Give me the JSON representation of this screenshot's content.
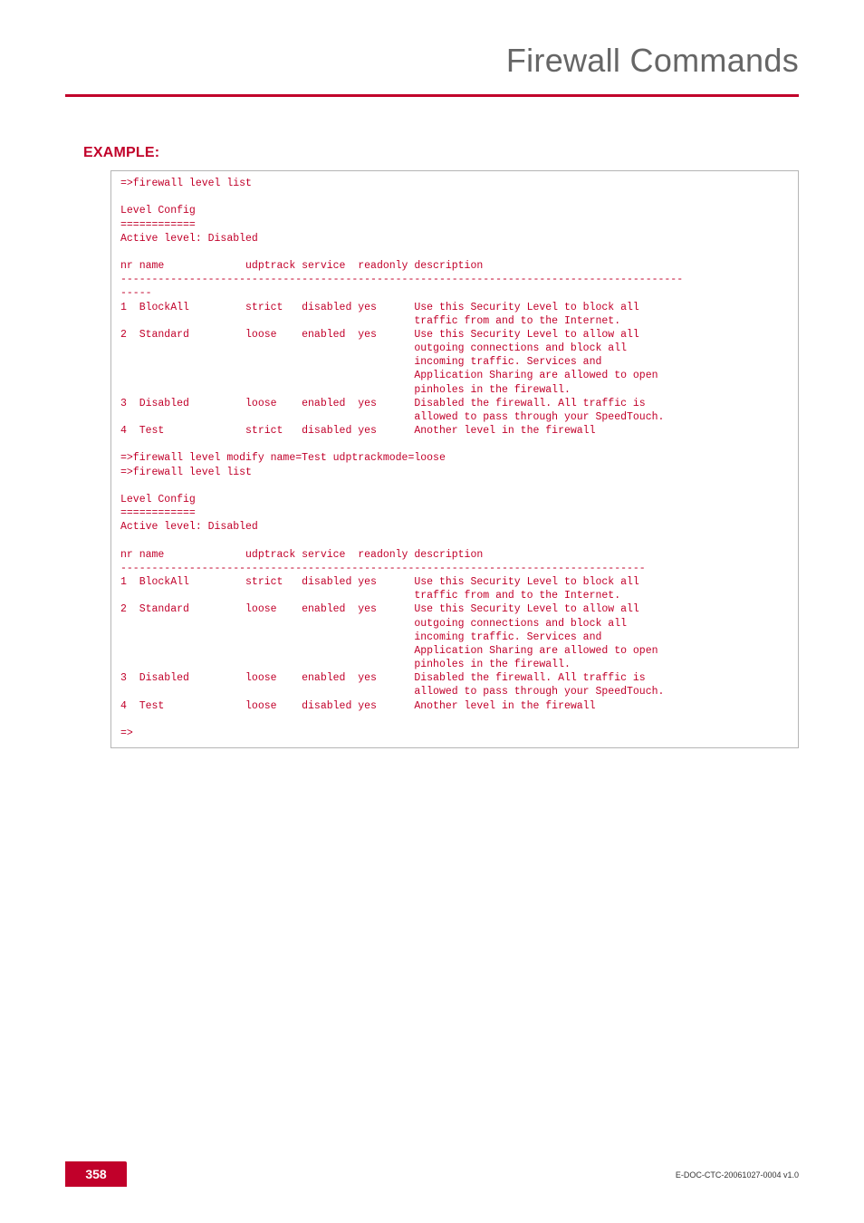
{
  "header": {
    "title": "Firewall Commands"
  },
  "section": {
    "label": "EXAMPLE:"
  },
  "code": {
    "body": "=>firewall level list\n\nLevel Config\n============\nActive level: Disabled\n\nnr name             udptrack service  readonly description\n------------------------------------------------------------------------------------------\n-----\n1  BlockAll         strict   disabled yes      Use this Security Level to block all\n                                               traffic from and to the Internet.\n2  Standard         loose    enabled  yes      Use this Security Level to allow all\n                                               outgoing connections and block all\n                                               incoming traffic. Services and\n                                               Application Sharing are allowed to open\n                                               pinholes in the firewall.\n3  Disabled         loose    enabled  yes      Disabled the firewall. All traffic is\n                                               allowed to pass through your SpeedTouch.\n4  Test             strict   disabled yes      Another level in the firewall\n\n=>firewall level modify name=Test udptrackmode=loose\n=>firewall level list\n\nLevel Config\n============\nActive level: Disabled\n\nnr name             udptrack service  readonly description\n------------------------------------------------------------------------------------\n1  BlockAll         strict   disabled yes      Use this Security Level to block all\n                                               traffic from and to the Internet.\n2  Standard         loose    enabled  yes      Use this Security Level to allow all\n                                               outgoing connections and block all\n                                               incoming traffic. Services and\n                                               Application Sharing are allowed to open\n                                               pinholes in the firewall.\n3  Disabled         loose    enabled  yes      Disabled the firewall. All traffic is\n                                               allowed to pass through your SpeedTouch.\n4  Test             loose    disabled yes      Another level in the firewall\n\n=>"
  },
  "footer": {
    "page_number": "358",
    "doc_id": "E-DOC-CTC-20061027-0004 v1.0"
  }
}
